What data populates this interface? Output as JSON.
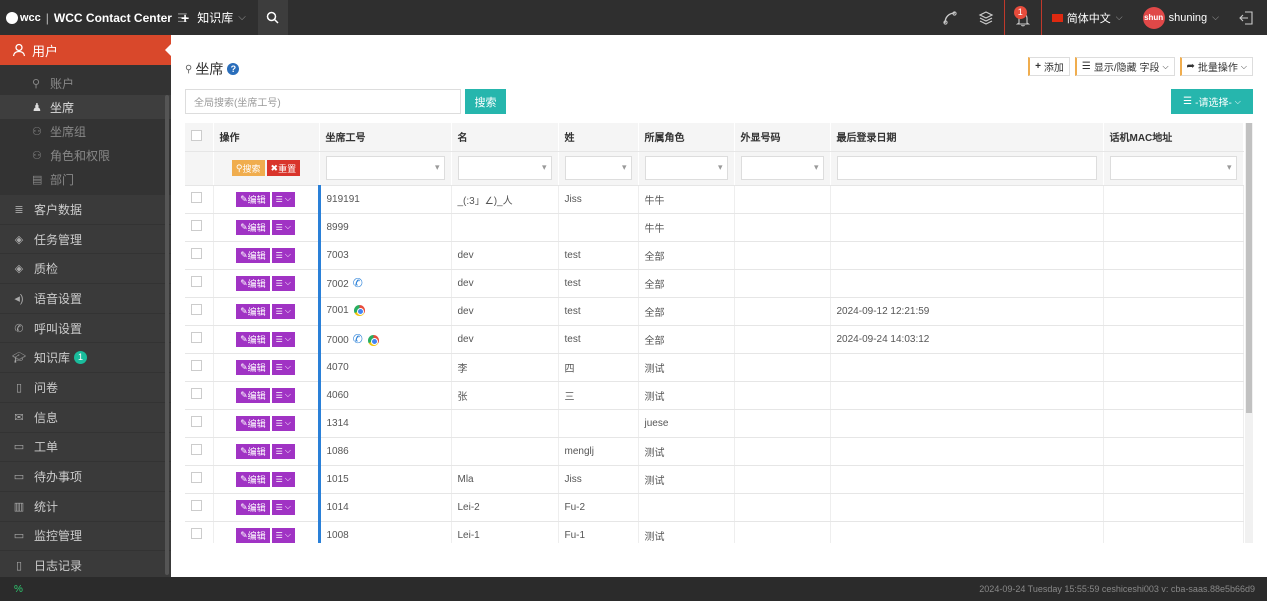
{
  "header": {
    "brand_logo": "wcc",
    "app_title": "WCC Contact Center",
    "menu_add": "知识库",
    "language": "简体中文",
    "username": "shuning",
    "avatar_text": "shun",
    "notification_count": "1"
  },
  "sidebar": {
    "active_section": "用户",
    "sub_items": [
      {
        "label": "账户",
        "icon": "user-outline-icon",
        "active": false
      },
      {
        "label": "坐席",
        "icon": "user-icon",
        "active": true
      },
      {
        "label": "坐席组",
        "icon": "users-icon",
        "active": false
      },
      {
        "label": "角色和权限",
        "icon": "roles-icon",
        "active": false
      },
      {
        "label": "部门",
        "icon": "department-icon",
        "active": false
      }
    ],
    "items": [
      {
        "label": "客户数据",
        "icon": "database-icon"
      },
      {
        "label": "任务管理",
        "icon": "layers-icon"
      },
      {
        "label": "质检",
        "icon": "layers-icon"
      },
      {
        "label": "语音设置",
        "icon": "volume-icon"
      },
      {
        "label": "呼叫设置",
        "icon": "phone-icon"
      },
      {
        "label": "知识库",
        "icon": "graduation-cap-icon",
        "badge": "1"
      },
      {
        "label": "问卷",
        "icon": "document-icon"
      },
      {
        "label": "信息",
        "icon": "envelope-icon"
      },
      {
        "label": "工单",
        "icon": "folder-icon"
      },
      {
        "label": "待办事项",
        "icon": "folder-icon"
      },
      {
        "label": "统计",
        "icon": "bar-chart-icon"
      },
      {
        "label": "监控管理",
        "icon": "monitor-icon"
      },
      {
        "label": "日志记录",
        "icon": "log-icon"
      }
    ]
  },
  "page": {
    "title": "坐席",
    "help": "?",
    "toolbar": {
      "add": "添加",
      "show_hide": "显示/隐藏 字段",
      "batch": "批量操作"
    },
    "search_placeholder": "全局搜索(坐席工号)",
    "search_button": "搜索",
    "select_button": "-请选择-"
  },
  "table": {
    "columns": [
      "操作",
      "坐席工号",
      "名",
      "姓",
      "所属角色",
      "外显号码",
      "最后登录日期",
      "话机MAC地址"
    ],
    "filter_search": "搜索",
    "filter_reset": "重置",
    "edit_label": "编辑",
    "rows": [
      {
        "id": "919191",
        "first": "_(:3」∠)_人",
        "last": "Jiss",
        "role": "牛牛",
        "display": "",
        "last_login": "",
        "mac": "",
        "phone": false,
        "chrome": false
      },
      {
        "id": "8999",
        "first": "",
        "last": "",
        "role": "牛牛",
        "display": "",
        "last_login": "",
        "mac": "",
        "phone": false,
        "chrome": false
      },
      {
        "id": "7003",
        "first": "dev",
        "last": "test",
        "role": "全部",
        "display": "",
        "last_login": "",
        "mac": "",
        "phone": false,
        "chrome": false
      },
      {
        "id": "7002",
        "first": "dev",
        "last": "test",
        "role": "全部",
        "display": "",
        "last_login": "",
        "mac": "",
        "phone": true,
        "chrome": false
      },
      {
        "id": "7001",
        "first": "dev",
        "last": "test",
        "role": "全部",
        "display": "",
        "last_login": "2024-09-12 12:21:59",
        "mac": "",
        "phone": false,
        "chrome": true
      },
      {
        "id": "7000",
        "first": "dev",
        "last": "test",
        "role": "全部",
        "display": "",
        "last_login": "2024-09-24 14:03:12",
        "mac": "",
        "phone": true,
        "chrome": true
      },
      {
        "id": "4070",
        "first": "李",
        "last": "四",
        "role": "测试",
        "display": "",
        "last_login": "",
        "mac": "",
        "phone": false,
        "chrome": false
      },
      {
        "id": "4060",
        "first": "张",
        "last": "三",
        "role": "测试",
        "display": "",
        "last_login": "",
        "mac": "",
        "phone": false,
        "chrome": false
      },
      {
        "id": "1314",
        "first": "",
        "last": "",
        "role": "juese",
        "display": "",
        "last_login": "",
        "mac": "",
        "phone": false,
        "chrome": false
      },
      {
        "id": "1086",
        "first": "",
        "last": "menglj",
        "role": "测试",
        "display": "",
        "last_login": "",
        "mac": "",
        "phone": false,
        "chrome": false
      },
      {
        "id": "1015",
        "first": "Mla",
        "last": "Jiss",
        "role": "测试",
        "display": "",
        "last_login": "",
        "mac": "",
        "phone": false,
        "chrome": false
      },
      {
        "id": "1014",
        "first": "Lei-2",
        "last": "Fu-2",
        "role": "",
        "display": "",
        "last_login": "",
        "mac": "",
        "phone": false,
        "chrome": false
      },
      {
        "id": "1008",
        "first": "Lei-1",
        "last": "Fu-1",
        "role": "测试",
        "display": "",
        "last_login": "",
        "mac": "",
        "phone": false,
        "chrome": false
      }
    ]
  },
  "footer": {
    "status_text": "2024-09-24 Tuesday 15:55:59  ceshiceshi003  v: cba-saas.88e5b66d9"
  },
  "colors": {
    "brand_red": "#d9482b",
    "teal": "#26b6ad",
    "purple": "#a033c4",
    "topbar": "#2f2f2f",
    "sidebar": "#3a3a3a"
  }
}
